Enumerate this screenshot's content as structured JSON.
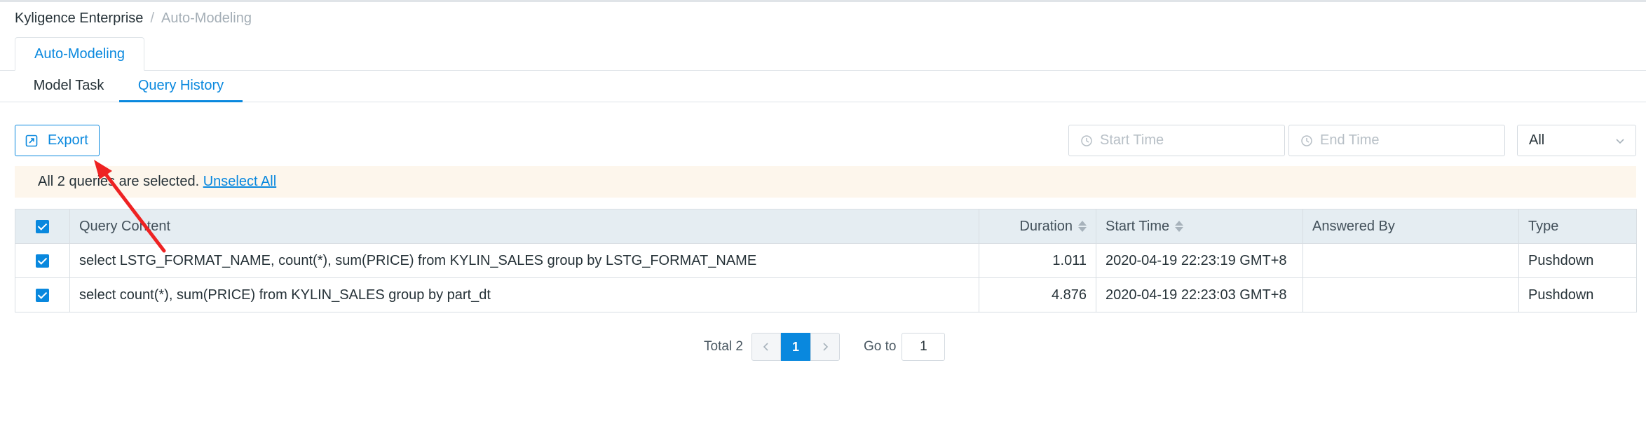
{
  "breadcrumb": {
    "home": "Kyligence Enterprise",
    "separator": "/",
    "current": "Auto-Modeling"
  },
  "top_tab": {
    "label": "Auto-Modeling"
  },
  "sub_tabs": [
    {
      "label": "Model Task",
      "active": false
    },
    {
      "label": "Query History",
      "active": true
    }
  ],
  "toolbar": {
    "export_label": "Export",
    "export_icon": "export-icon",
    "start_time_placeholder": "Start Time",
    "end_time_placeholder": "End Time",
    "clock_icon": "clock-icon",
    "type_filter_value": "All",
    "type_filter_icon": "chevron-down-icon"
  },
  "notice": {
    "text": "All 2 queries are selected.",
    "link": "Unselect All"
  },
  "table": {
    "columns": [
      "Query Content",
      "Duration",
      "Start Time",
      "Answered By",
      "Type"
    ],
    "rows": [
      {
        "query": "select LSTG_FORMAT_NAME, count(*), sum(PRICE) from KYLIN_SALES group by LSTG_FORMAT_NAME",
        "duration": "1.011",
        "start_time": "2020-04-19 22:23:19 GMT+8",
        "answered_by": "",
        "type": "Pushdown"
      },
      {
        "query": "select count(*), sum(PRICE) from KYLIN_SALES group by part_dt",
        "duration": "4.876",
        "start_time": "2020-04-19 22:23:03 GMT+8",
        "answered_by": "",
        "type": "Pushdown"
      }
    ]
  },
  "pagination": {
    "total": "Total 2",
    "current_page": "1",
    "goto_label": "Go to",
    "goto_value": "1"
  },
  "colors": {
    "accent": "#0988de",
    "notice_bg": "#fdf6ec",
    "header_bg": "#e5edf2",
    "annotation_arrow": "#ee2222"
  }
}
